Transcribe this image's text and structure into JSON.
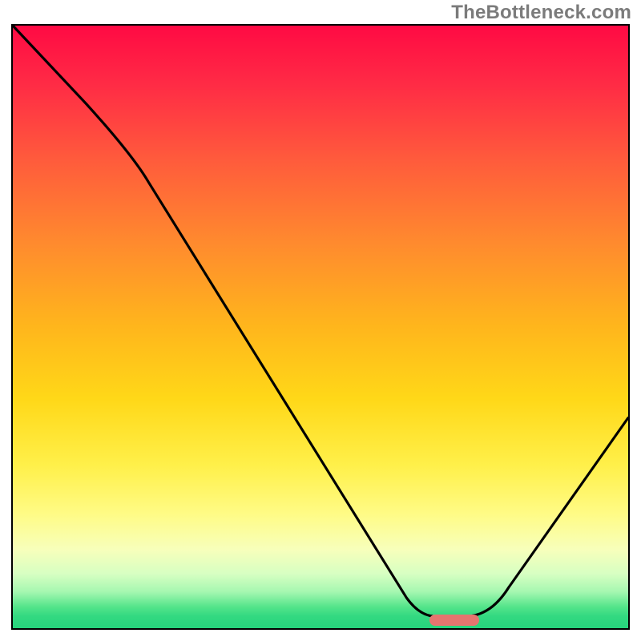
{
  "watermark": "TheBottleneck.com",
  "chart_data": {
    "type": "line",
    "title": "",
    "xlabel": "",
    "ylabel": "",
    "xlim": [
      0,
      100
    ],
    "ylim": [
      0,
      100
    ],
    "grid": false,
    "legend": false,
    "series": [
      {
        "name": "bottleneck-curve",
        "x": [
          0,
          12,
          20,
          64,
          67,
          73,
          78,
          100
        ],
        "values": [
          100,
          87,
          78,
          5,
          2,
          2,
          4,
          35
        ]
      }
    ],
    "annotations": [
      {
        "name": "optimal-marker",
        "type": "pill",
        "x_start": 67,
        "x_end": 76,
        "y": 2,
        "color": "#e6756f"
      }
    ],
    "background_gradient": {
      "stops": [
        {
          "pos": 0,
          "color": "#ff0a44"
        },
        {
          "pos": 0.5,
          "color": "#ffb61c"
        },
        {
          "pos": 0.81,
          "color": "#fffb85"
        },
        {
          "pos": 1.0,
          "color": "#26d47c"
        }
      ]
    }
  }
}
